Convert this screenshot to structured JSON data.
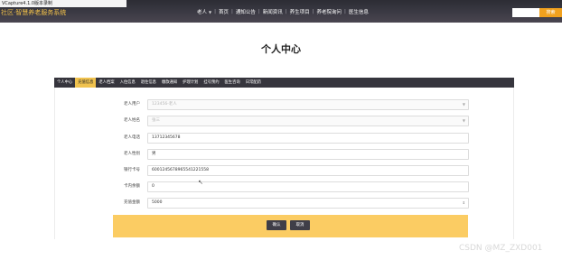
{
  "window": {
    "caption": "VCapture4.1.0版本录制"
  },
  "header": {
    "site_title": "社区·智慧养老服务系统",
    "nav": [
      "老人",
      "首页",
      "通知公告",
      "新闻资讯",
      "养生项目",
      "养老院询问",
      "医生信息"
    ],
    "search_button": "搜索"
  },
  "page": {
    "title": "个人中心"
  },
  "tabs": [
    "个人中心",
    "充值信息",
    "老人档案",
    "入住信息",
    "退住信息",
    "缴款通知",
    "护理计划",
    "挂号预约",
    "医生咨询",
    "日常配药"
  ],
  "form": {
    "fields": [
      {
        "label": "老人用户",
        "value": "123456-老人",
        "type": "select"
      },
      {
        "label": "老人姓名",
        "value": "张三",
        "type": "select"
      },
      {
        "label": "老人电话",
        "value": "13712345678",
        "type": "text"
      },
      {
        "label": "老人性别",
        "value": "男",
        "type": "text"
      },
      {
        "label": "银行卡号",
        "value": "6001245678965541221558",
        "type": "text"
      },
      {
        "label": "卡内余额",
        "value": "0",
        "type": "text"
      },
      {
        "label": "充值金额",
        "value": "5000",
        "type": "number"
      }
    ],
    "confirm_label": "确认",
    "cancel_label": "取消"
  },
  "watermark": "CSDN @MZ_ZXD001",
  "colors": {
    "accent": "#f0c24e",
    "dark_bar": "#36353d",
    "button_bar": "#fbcc63"
  }
}
